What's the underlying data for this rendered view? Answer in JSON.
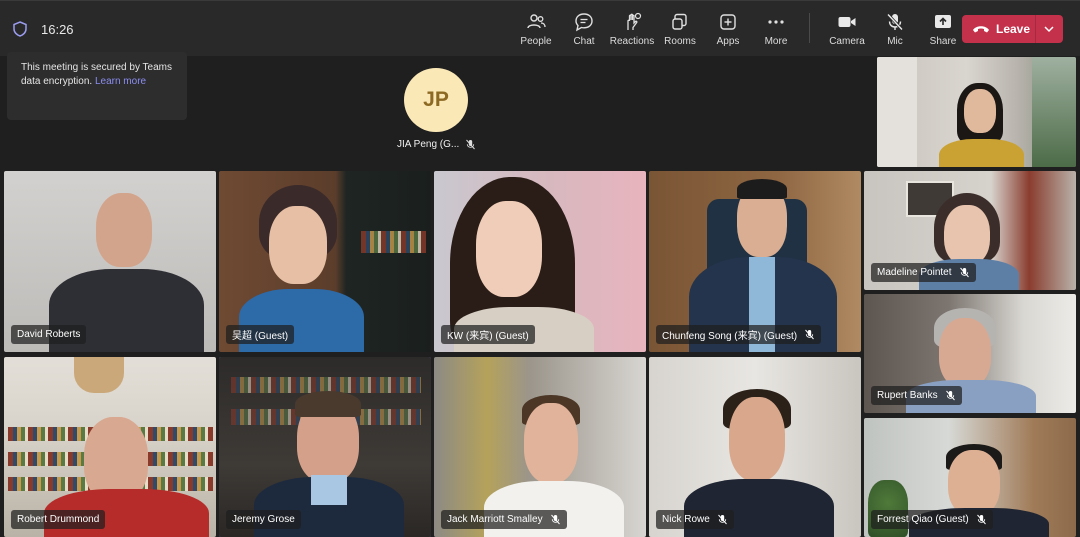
{
  "topbar": {
    "time": "16:26",
    "tools": [
      {
        "label": "People",
        "icon": "people-icon"
      },
      {
        "label": "Chat",
        "icon": "chat-icon"
      },
      {
        "label": "Reactions",
        "icon": "reactions-icon"
      },
      {
        "label": "Rooms",
        "icon": "rooms-icon"
      },
      {
        "label": "Apps",
        "icon": "apps-icon"
      },
      {
        "label": "More",
        "icon": "more-icon"
      }
    ],
    "media": [
      {
        "label": "Camera",
        "icon": "camera-icon"
      },
      {
        "label": "Mic",
        "icon": "mic-off-icon"
      },
      {
        "label": "Share",
        "icon": "share-icon"
      }
    ],
    "leave_label": "Leave"
  },
  "toast": {
    "text": "This meeting is secured by Teams data encryption.",
    "link": "Learn more"
  },
  "avatar_participant": {
    "initials": "JP",
    "name": "JIA Peng (G...",
    "muted": true
  },
  "participants": [
    {
      "name": "David Roberts",
      "muted": false
    },
    {
      "name": "吴超 (Guest)",
      "muted": false
    },
    {
      "name": "KW (来宾) (Guest)",
      "muted": false
    },
    {
      "name": "Chunfeng Song (来宾) (Guest)",
      "muted": true
    },
    {
      "name": "Madeline Pointet",
      "muted": true
    },
    {
      "name": "Rupert Banks",
      "muted": true
    },
    {
      "name": "Robert Drummond",
      "muted": false
    },
    {
      "name": "Jeremy Grose",
      "muted": false
    },
    {
      "name": "Jack Marriott Smalley",
      "muted": true
    },
    {
      "name": "Nick Rowe",
      "muted": true
    },
    {
      "name": "Forrest Qiao (Guest)",
      "muted": true
    }
  ],
  "colors": {
    "leave": "#c4314b",
    "accent": "#8c8df5",
    "avatar_bg": "#fbe8b7"
  }
}
